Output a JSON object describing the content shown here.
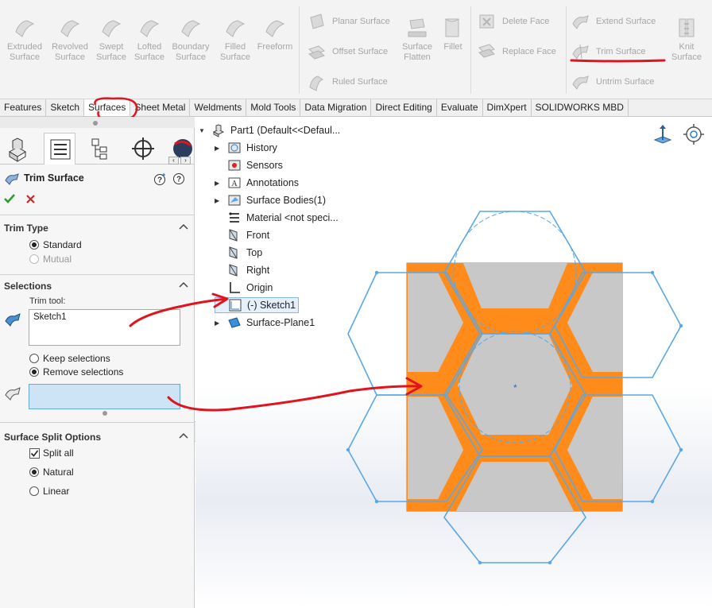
{
  "ribbon": {
    "group1": [
      {
        "id": "extruded",
        "label": "Extruded Surface",
        "line1": "Extruded",
        "line2": "Surface"
      },
      {
        "id": "revolved",
        "label": "Revolved Surface",
        "line1": "Revolved",
        "line2": "Surface"
      },
      {
        "id": "swept",
        "label": "Swept Surface",
        "line1": "Swept",
        "line2": "Surface"
      },
      {
        "id": "lofted",
        "label": "Lofted Surface",
        "line1": "Lofted",
        "line2": "Surface"
      },
      {
        "id": "boundary",
        "label": "Boundary Surface",
        "line1": "Boundary",
        "line2": "Surface"
      },
      {
        "id": "filled",
        "label": "Filled Surface",
        "line1": "Filled",
        "line2": "Surface"
      },
      {
        "id": "freeform",
        "label": "Freeform",
        "line1": "Freeform",
        "line2": ""
      }
    ],
    "planar": "Planar Surface",
    "offset": "Offset Surface",
    "ruled": "Ruled Surface",
    "flatten_1": "Surface",
    "flatten_2": "Flatten",
    "fillet": "Fillet",
    "delete_face": "Delete Face",
    "replace_face": "Replace Face",
    "extend": "Extend Surface",
    "trim": "Trim Surface",
    "untrim": "Untrim Surface",
    "knit_1": "Knit",
    "knit_2": "Surface"
  },
  "tabs": [
    "Features",
    "Sketch",
    "Surfaces",
    "Sheet Metal",
    "Weldments",
    "Mold Tools",
    "Data Migration",
    "Direct Editing",
    "Evaluate",
    "DimXpert",
    "SOLIDWORKS MBD"
  ],
  "active_tab": "Surfaces",
  "panel": {
    "title": "Trim Surface",
    "trim_type": {
      "title": "Trim Type",
      "standard": "Standard",
      "mutual": "Mutual"
    },
    "selections": {
      "title": "Selections",
      "trim_tool_label": "Trim tool:",
      "trim_tool_value": "Sketch1",
      "keep": "Keep selections",
      "remove": "Remove selections"
    },
    "split": {
      "title": "Surface Split Options",
      "split_all": "Split all",
      "natural": "Natural",
      "linear": "Linear"
    }
  },
  "tree": {
    "root": "Part1  (Default<<Defaul...",
    "items": [
      {
        "label": "History",
        "expandable": true
      },
      {
        "label": "Sensors",
        "expandable": false
      },
      {
        "label": "Annotations",
        "expandable": true
      },
      {
        "label": "Surface Bodies(1)",
        "expandable": true
      },
      {
        "label": "Material <not speci...",
        "expandable": false
      },
      {
        "label": "Front",
        "expandable": false
      },
      {
        "label": "Top",
        "expandable": false
      },
      {
        "label": "Right",
        "expandable": false
      },
      {
        "label": "Origin",
        "expandable": false
      },
      {
        "label": "(-) Sketch1",
        "expandable": false
      },
      {
        "label": "Surface-Plane1",
        "expandable": true
      }
    ]
  },
  "colors": {
    "accent_orange": "#ff8c1a",
    "surface_gray": "#c8c8c8",
    "sketch_blue": "#5aa7e6",
    "annotation_red": "#e0141e",
    "field_highlight": "#cde4f7"
  }
}
